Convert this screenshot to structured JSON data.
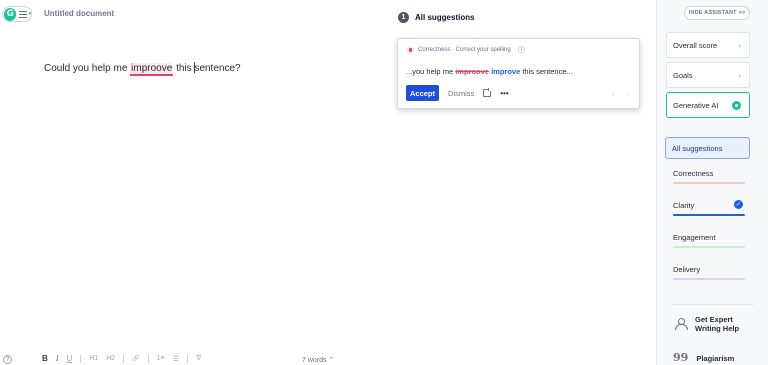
{
  "app": {
    "logo_letter": "G",
    "menu_caret": "▾"
  },
  "document": {
    "title": "Untitled document",
    "text_before": "Could you help me ",
    "error_word": "improove",
    "text_after_1": " this ",
    "text_after_2": "sentence?"
  },
  "suggestions_header": {
    "count": "1",
    "title": "All suggestions"
  },
  "card": {
    "category_line": "Correctness · Correct your spelling",
    "info_icon": "ⓘ",
    "context_prefix": "...you help me ",
    "wrong_word": "improove",
    "replacement": "improve",
    "context_suffix": " this sentence...",
    "accept_label": "Accept",
    "dismiss_label": "Dismiss",
    "more_label": "•••",
    "prev_arrow": "‹",
    "next_arrow": "›"
  },
  "sidebar": {
    "hide_label": "HIDE ASSISTANT >>",
    "overall_score": "Overall score",
    "goals": "Goals",
    "generative_ai": "Generative AI",
    "chevron": "›",
    "all_suggestions": "All suggestions",
    "categories": [
      {
        "label": "Correctness",
        "color": "#f3c5cf"
      },
      {
        "label": "Clarity",
        "color": "#1d61e6"
      },
      {
        "label": "Engagement",
        "color": "#c8ecd9"
      },
      {
        "label": "Delivery",
        "color": "#d9d3f0"
      }
    ],
    "clarity_check": "✓",
    "expert_help": "Get Expert Writing Help",
    "plagiarism": "Plagiarism",
    "plagiarism_icon": "99"
  },
  "toolbar": {
    "help": "?",
    "bold": "B",
    "italic": "I",
    "underline": "U",
    "h1": "H1",
    "h2": "H2",
    "link": "🔗",
    "ordered_list": "1≡",
    "bullet_list": "☰",
    "clear_format": "T̸",
    "word_count": "7 words ⌃"
  },
  "colors": {
    "accent_green": "#15c39a",
    "error_red": "#e0426a",
    "primary_blue": "#1d4fd8"
  }
}
